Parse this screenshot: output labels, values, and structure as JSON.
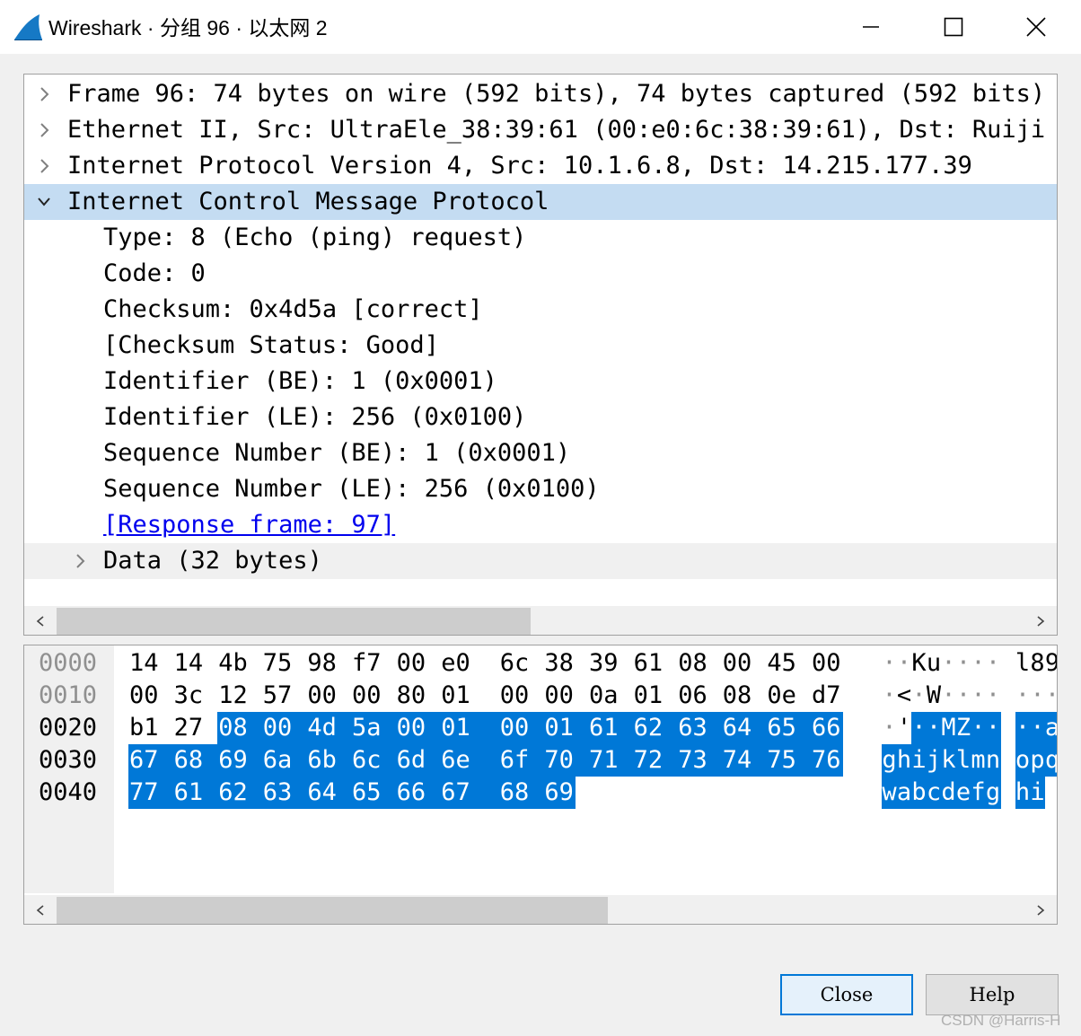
{
  "window": {
    "title": "Wireshark · 分组 96 · 以太网 2",
    "icon": "wireshark-fin-icon",
    "controls": [
      "minimize-icon",
      "maximize-icon",
      "close-icon"
    ]
  },
  "tree": {
    "rows": [
      {
        "text": "Frame 96: 74 bytes on wire (592 bits), 74 bytes captured (592 bits)",
        "level": 0,
        "arrow": "right",
        "state": ""
      },
      {
        "text": "Ethernet II, Src: UltraEle_38:39:61 (00:e0:6c:38:39:61), Dst: Ruiji",
        "level": 0,
        "arrow": "right",
        "state": ""
      },
      {
        "text": "Internet Protocol Version 4, Src: 10.1.6.8, Dst: 14.215.177.39",
        "level": 0,
        "arrow": "right",
        "state": ""
      },
      {
        "text": "Internet Control Message Protocol",
        "level": 0,
        "arrow": "down",
        "state": "selected"
      },
      {
        "text": "Type: 8 (Echo (ping) request)",
        "level": 1,
        "arrow": "",
        "state": ""
      },
      {
        "text": "Code: 0",
        "level": 1,
        "arrow": "",
        "state": ""
      },
      {
        "text": "Checksum: 0x4d5a [correct]",
        "level": 1,
        "arrow": "",
        "state": ""
      },
      {
        "text": "[Checksum Status: Good]",
        "level": 1,
        "arrow": "",
        "state": ""
      },
      {
        "text": "Identifier (BE): 1 (0x0001)",
        "level": 1,
        "arrow": "",
        "state": ""
      },
      {
        "text": "Identifier (LE): 256 (0x0100)",
        "level": 1,
        "arrow": "",
        "state": ""
      },
      {
        "text": "Sequence Number (BE): 1 (0x0001)",
        "level": 1,
        "arrow": "",
        "state": ""
      },
      {
        "text": "Sequence Number (LE): 256 (0x0100)",
        "level": 1,
        "arrow": "",
        "state": ""
      },
      {
        "text": "[Response frame: 97]",
        "level": 1,
        "arrow": "",
        "state": "link"
      },
      {
        "text": "Data (32 bytes)",
        "level": 1,
        "arrow": "right",
        "state": "hover"
      }
    ],
    "scroll_position": 0.0,
    "scroll_visible_fraction": 0.49
  },
  "bytes": {
    "rows": [
      {
        "offset": "0000",
        "dim": true,
        "hex": [
          "14",
          "14",
          "4b",
          "75",
          "98",
          "f7",
          "00",
          "e0",
          "6c",
          "38",
          "39",
          "61",
          "08",
          "00",
          "45",
          "00"
        ],
        "ascii": [
          "·",
          "·",
          "K",
          "u",
          "·",
          "·",
          "·",
          "·",
          "",
          "l",
          "8",
          "9"
        ]
      },
      {
        "offset": "0010",
        "dim": true,
        "hex": [
          "00",
          "3c",
          "12",
          "57",
          "00",
          "00",
          "80",
          "01",
          "00",
          "00",
          "0a",
          "01",
          "06",
          "08",
          "0e",
          "d7"
        ],
        "ascii": [
          "·",
          "<",
          "·",
          "W",
          "·",
          "·",
          "·",
          "·",
          "",
          "·",
          "·",
          "·"
        ]
      },
      {
        "offset": "0020",
        "dim": false,
        "hex": [
          "b1",
          "27",
          "08",
          "00",
          "4d",
          "5a",
          "00",
          "01",
          "00",
          "01",
          "61",
          "62",
          "63",
          "64",
          "65",
          "66"
        ],
        "ascii": [
          "·",
          "'",
          "·",
          "·",
          "M",
          "Z",
          "·",
          "·",
          "",
          "·",
          "·",
          "a"
        ]
      },
      {
        "offset": "0030",
        "dim": false,
        "hex": [
          "67",
          "68",
          "69",
          "6a",
          "6b",
          "6c",
          "6d",
          "6e",
          "6f",
          "70",
          "71",
          "72",
          "73",
          "74",
          "75",
          "76"
        ],
        "ascii": [
          "g",
          "h",
          "i",
          "j",
          "k",
          "l",
          "m",
          "n",
          "",
          "o",
          "p",
          "q"
        ]
      },
      {
        "offset": "0040",
        "dim": false,
        "hex": [
          "77",
          "61",
          "62",
          "63",
          "64",
          "65",
          "66",
          "67",
          "68",
          "69"
        ],
        "ascii": [
          "w",
          "a",
          "b",
          "c",
          "d",
          "e",
          "f",
          "g",
          "",
          "h",
          "i"
        ]
      }
    ],
    "highlight_start": 34,
    "highlight_end": 73,
    "scroll_position": 0.0,
    "scroll_visible_fraction": 0.57
  },
  "buttons": {
    "close_label": "Close",
    "help_label": "Help"
  },
  "watermark": "CSDN @Harris-H",
  "colors": {
    "selection": "#c4dcf2",
    "byte_highlight": "#0078d7",
    "link": "#0000ee"
  }
}
